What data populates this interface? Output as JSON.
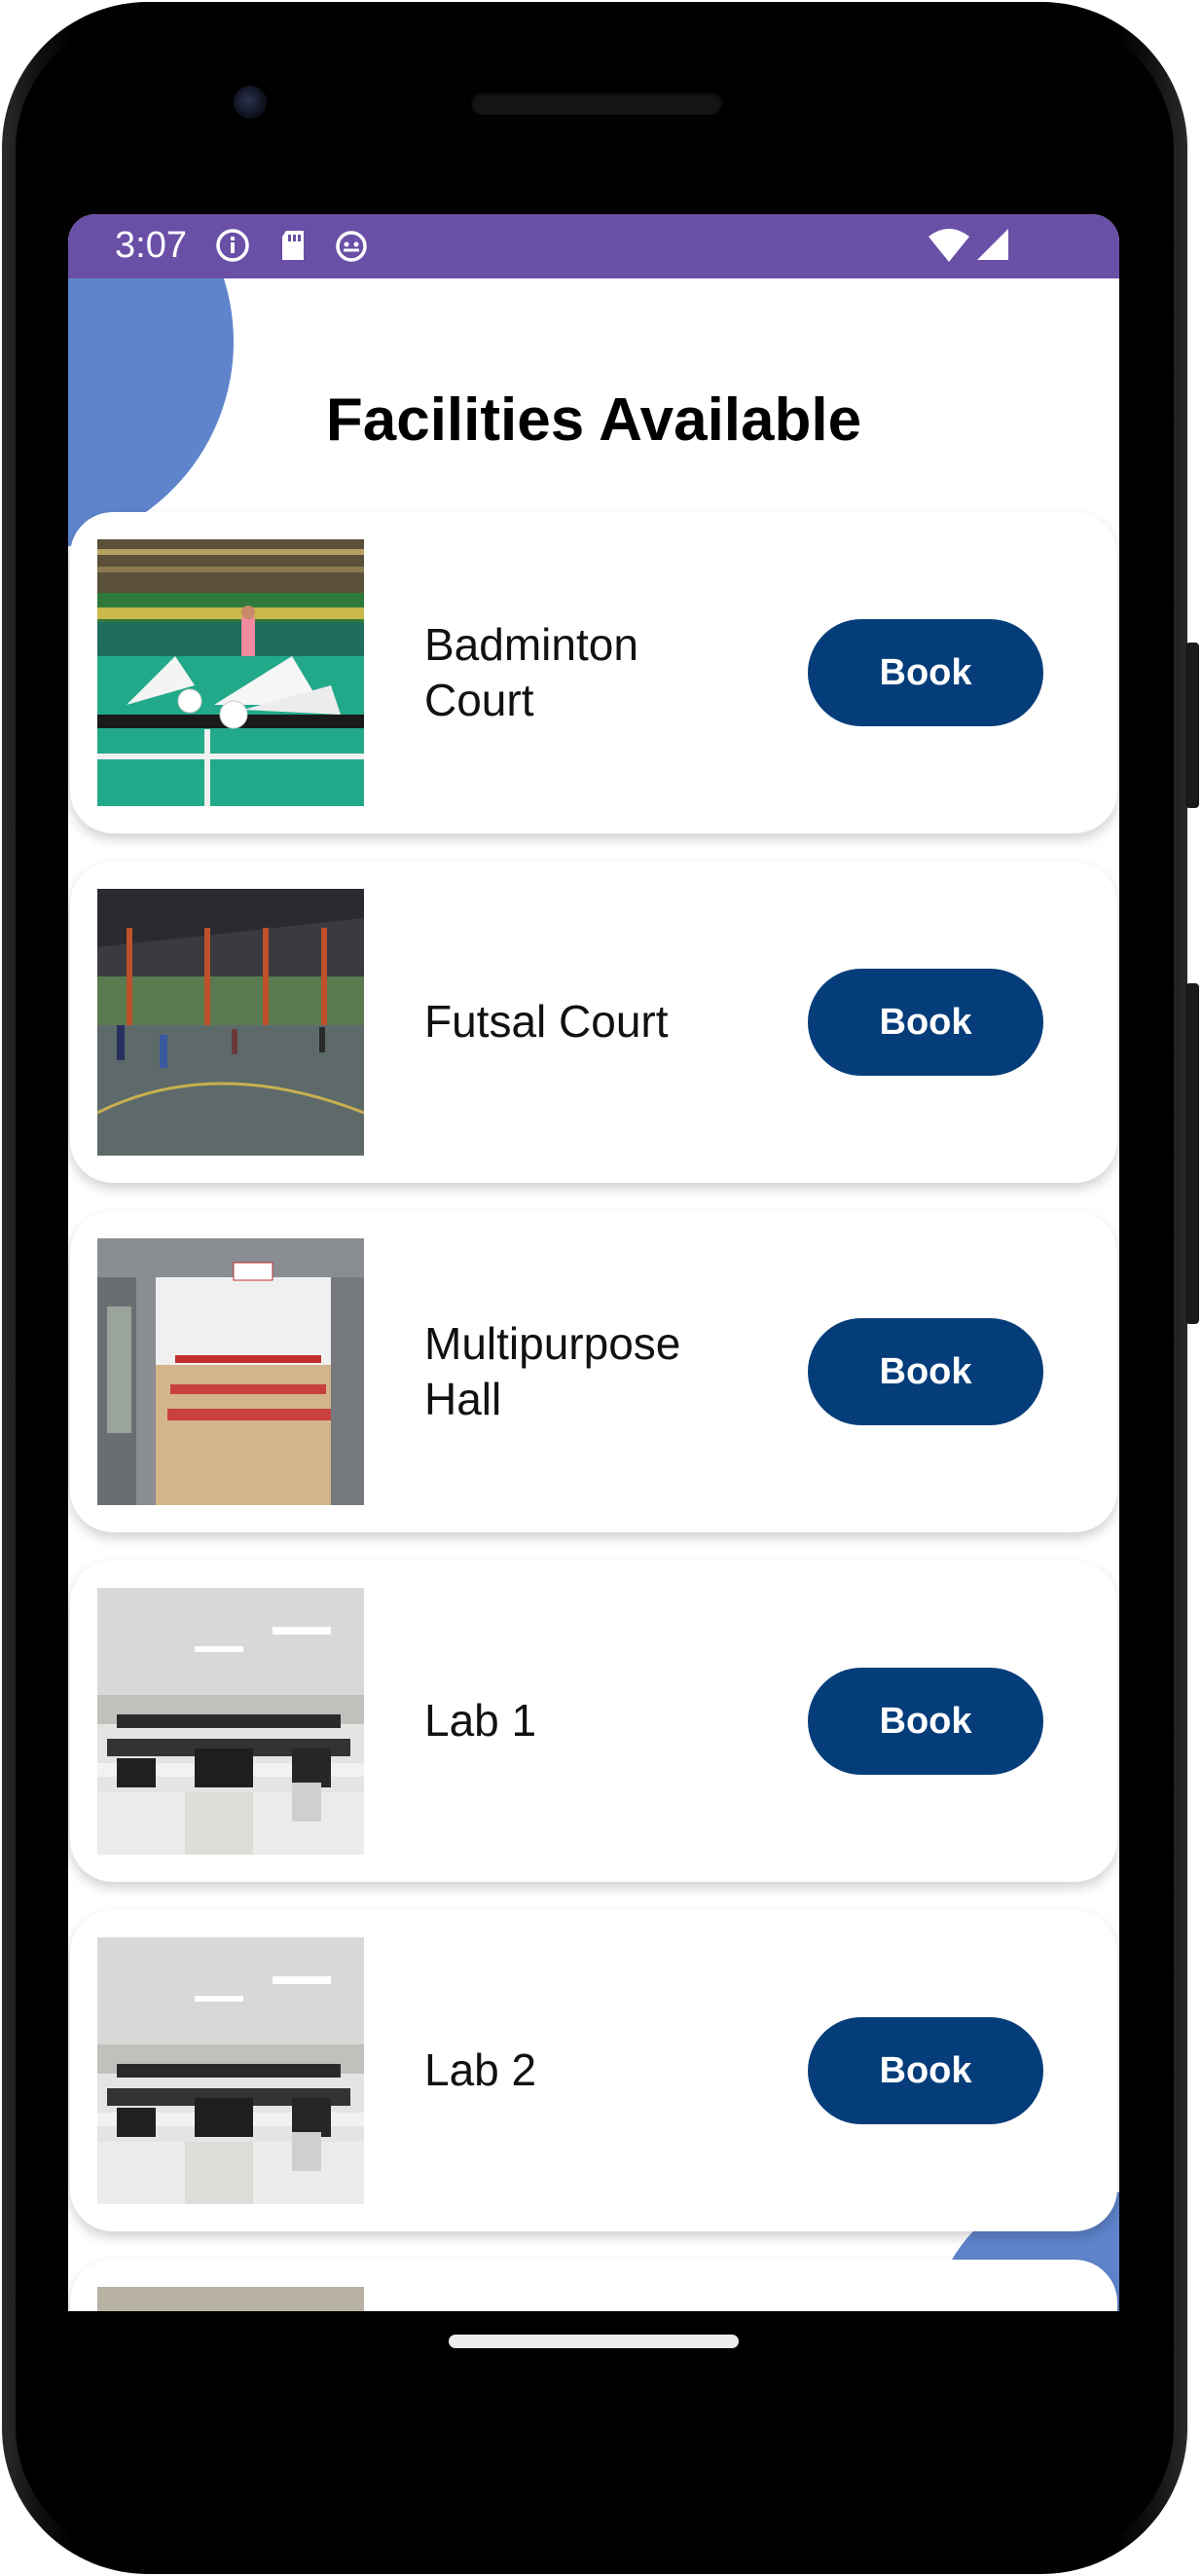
{
  "status_bar": {
    "time": "3:07",
    "color": "#6a4fa6",
    "icons": [
      "info-icon",
      "sd-card-icon",
      "android-debug-icon",
      "wifi-icon",
      "signal-icon"
    ]
  },
  "page": {
    "title": "Facilities Available",
    "accent_color": "#5f84cc",
    "button_color": "#053d7a"
  },
  "facilities": [
    {
      "name": "Badminton Court",
      "button_label": "Book",
      "image": "badminton-court-photo"
    },
    {
      "name": "Futsal Court",
      "button_label": "Book",
      "image": "futsal-court-photo"
    },
    {
      "name": "Multipurpose Hall",
      "button_label": "Book",
      "image": "multipurpose-hall-photo"
    },
    {
      "name": "Lab 1",
      "button_label": "Book",
      "image": "computer-lab-photo"
    },
    {
      "name": "Lab 2",
      "button_label": "Book",
      "image": "computer-lab-photo"
    }
  ]
}
